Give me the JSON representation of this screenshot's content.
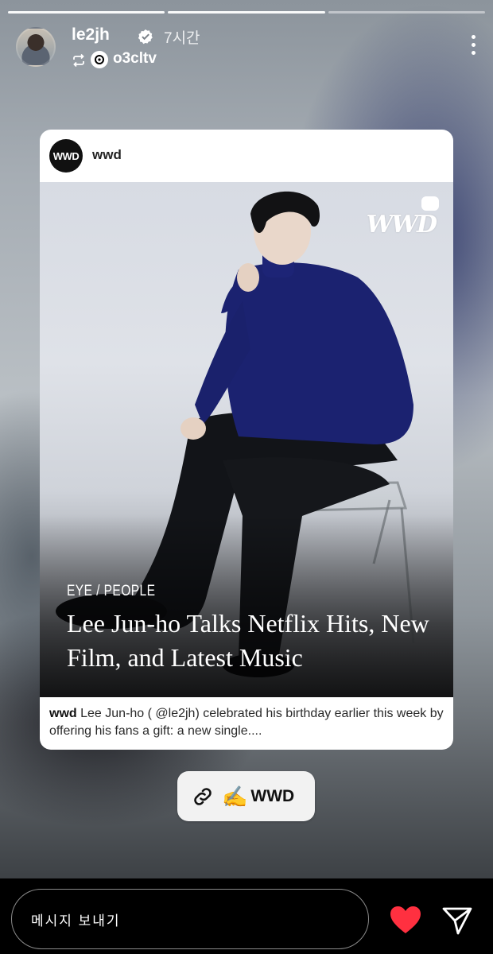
{
  "story": {
    "progress_segments": 3,
    "progress_done": 2,
    "author": {
      "username": "le2jh",
      "verified": true,
      "time": "7시간",
      "source": "o3cltv",
      "avatar_icon": "profile-avatar"
    }
  },
  "shared_post": {
    "account": "wwd",
    "account_avatar_text": "WWD",
    "logo_text": "WWD",
    "kicker": "EYE / PEOPLE",
    "headline": "Lee Jun-ho Talks Netflix Hits, New Film, and Latest Music",
    "caption_user": "wwd",
    "caption_text": "Lee Jun-ho ( @le2jh) celebrated his birthday earlier this week by offering his fans a gift: a new single...."
  },
  "link_sticker": {
    "emoji": "✍️",
    "label": "WWD"
  },
  "bottom_bar": {
    "message_placeholder": "메시지 보내기",
    "like_color": "#ff3040"
  }
}
